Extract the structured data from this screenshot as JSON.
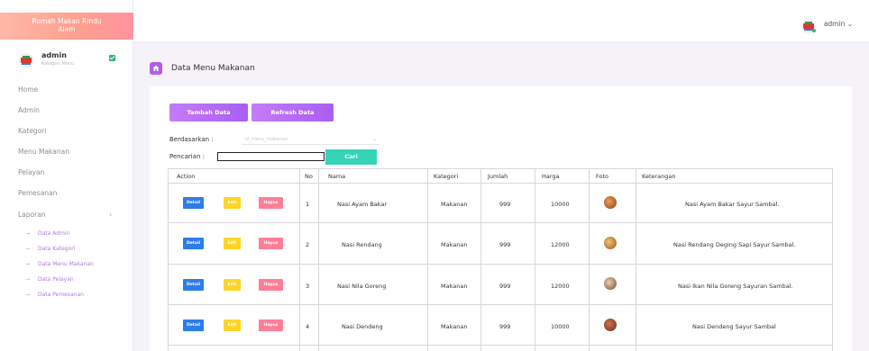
{
  "brand": {
    "line1": "Rumah Makan Rindu",
    "line2": "Alam"
  },
  "user": {
    "name": "admin",
    "role": "Kategori Menu"
  },
  "sidebar": {
    "items": [
      {
        "label": "Home"
      },
      {
        "label": "Admin"
      },
      {
        "label": "Kategori"
      },
      {
        "label": "Menu Makanan"
      },
      {
        "label": "Pelayan"
      },
      {
        "label": "Pemesanan"
      },
      {
        "label": "Laporan"
      }
    ],
    "subitems": [
      {
        "label": "Data Admin"
      },
      {
        "label": "Data Kategori"
      },
      {
        "label": "Data Menu Makanan"
      },
      {
        "label": "Data Pelayan"
      },
      {
        "label": "Data Pemesanan"
      }
    ]
  },
  "topbar": {
    "user_label": "admin ⌄"
  },
  "page": {
    "title": "Data Menu Makanan"
  },
  "toolbar": {
    "add_label": "Tambah Data",
    "refresh_label": "Refresh Data"
  },
  "filter": {
    "by_label": "Berdasarkan :",
    "by_value": "id_menu_makanan",
    "search_label": "Pencarian   :",
    "search_button": "Cari"
  },
  "table": {
    "headers": [
      "Action",
      "No",
      "Nama",
      "Kategori",
      "Jumlah",
      "Harga",
      "Foto",
      "Keterangan"
    ],
    "action_labels": {
      "detail": "Detail",
      "edit": "Edit",
      "hapus": "Hapus"
    },
    "rows": [
      {
        "no": "1",
        "nama": "Nasi Ayam Bakar",
        "kategori": "Makanan",
        "jumlah": "999",
        "harga": "10000",
        "keterangan": "Nasi Ayam Bakar Sayur Sambal."
      },
      {
        "no": "2",
        "nama": "Nasi Rendang",
        "kategori": "Makanan",
        "jumlah": "999",
        "harga": "12000",
        "keterangan": "Nasi Rendang Deging Sapi Sayur Sambal."
      },
      {
        "no": "3",
        "nama": "Nasi Nila Goreng",
        "kategori": "Makanan",
        "jumlah": "999",
        "harga": "12000",
        "keterangan": "Nasi Ikan Nila Goreng Sayuran Sambal."
      },
      {
        "no": "4",
        "nama": "Nasi Dendeng",
        "kategori": "Makanan",
        "jumlah": "999",
        "harga": "10000",
        "keterangan": "Nasi Dendeng Sayur Sambal"
      }
    ]
  },
  "colors": {
    "accent": "#b35cf0",
    "cari": "#35d3b7",
    "detail": "#2b7de9",
    "edit": "#ffd426",
    "hapus": "#ff7e96"
  }
}
